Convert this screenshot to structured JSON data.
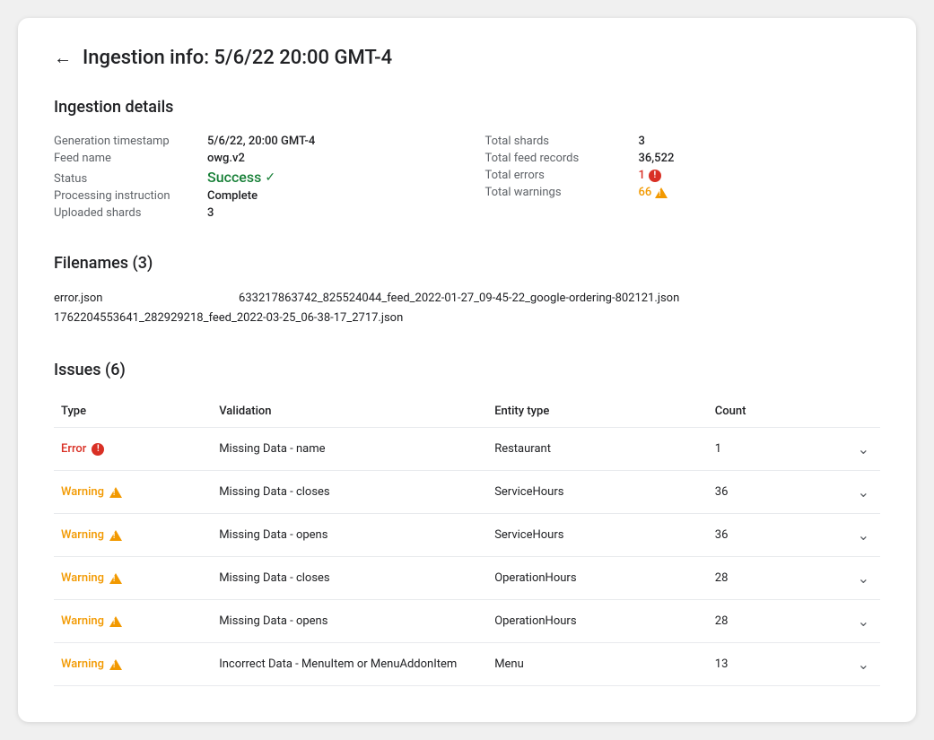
{
  "page": {
    "title": "Ingestion info: 5/6/22 20:00 GMT-4",
    "back_label": "←"
  },
  "ingestion_details": {
    "section_title": "Ingestion details",
    "left": [
      {
        "label": "Generation timestamp",
        "value": "5/6/22, 20:00 GMT-4"
      },
      {
        "label": "Feed name",
        "value": "owg.v2"
      },
      {
        "label": "Status",
        "value": "Success",
        "type": "success"
      },
      {
        "label": "Processing instruction",
        "value": "Complete"
      },
      {
        "label": "Uploaded shards",
        "value": "3"
      }
    ],
    "right": [
      {
        "label": "Total shards",
        "value": "3"
      },
      {
        "label": "Total feed records",
        "value": "36,522"
      },
      {
        "label": "Total errors",
        "value": "1",
        "type": "error"
      },
      {
        "label": "Total warnings",
        "value": "66",
        "type": "warning"
      }
    ]
  },
  "filenames": {
    "section_title": "Filenames (3)",
    "files": [
      "error.json",
      "633217863742_825524044_feed_2022-01-27_09-45-22_google-ordering-802121.json",
      "1762204553641_282929218_feed_2022-03-25_06-38-17_2717.json"
    ]
  },
  "issues": {
    "section_title": "Issues (6)",
    "columns": [
      "Type",
      "Validation",
      "Entity type",
      "Count"
    ],
    "rows": [
      {
        "type": "Error",
        "type_kind": "error",
        "validation": "Missing Data - name",
        "entity_type": "Restaurant",
        "count": "1"
      },
      {
        "type": "Warning",
        "type_kind": "warning",
        "validation": "Missing Data - closes",
        "entity_type": "ServiceHours",
        "count": "36"
      },
      {
        "type": "Warning",
        "type_kind": "warning",
        "validation": "Missing Data - opens",
        "entity_type": "ServiceHours",
        "count": "36"
      },
      {
        "type": "Warning",
        "type_kind": "warning",
        "validation": "Missing Data - closes",
        "entity_type": "OperationHours",
        "count": "28"
      },
      {
        "type": "Warning",
        "type_kind": "warning",
        "validation": "Missing Data - opens",
        "entity_type": "OperationHours",
        "count": "28"
      },
      {
        "type": "Warning",
        "type_kind": "warning",
        "validation": "Incorrect Data - MenuItem or MenuAddonItem",
        "entity_type": "Menu",
        "count": "13"
      }
    ]
  }
}
